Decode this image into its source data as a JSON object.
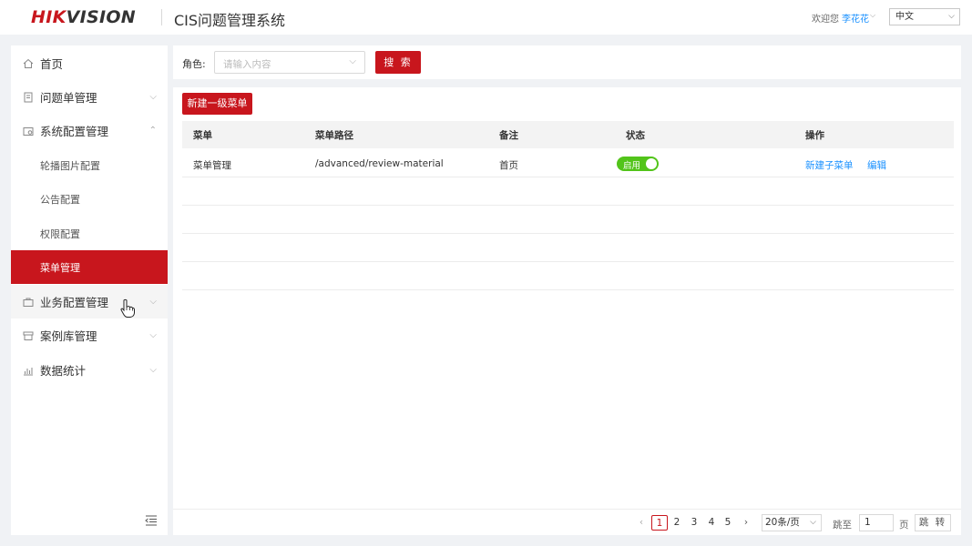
{
  "header": {
    "logo_main": "HIK",
    "logo_accent": "VISION",
    "app_title": "CIS问题管理系统",
    "welcome_text": "欢迎您",
    "username": "李花花",
    "language": "中文"
  },
  "sidebar": {
    "items": [
      {
        "label": "首页",
        "icon": "home-icon"
      },
      {
        "label": "问题单管理",
        "icon": "document-icon"
      },
      {
        "label": "系统配置管理",
        "icon": "settings-folder-icon",
        "expanded": true
      },
      {
        "label": "轮播图片配置"
      },
      {
        "label": "公告配置"
      },
      {
        "label": "权限配置"
      },
      {
        "label": "菜单管理",
        "active": true
      },
      {
        "label": "业务配置管理",
        "icon": "briefcase-icon"
      },
      {
        "label": "案例库管理",
        "icon": "archive-icon"
      },
      {
        "label": "数据统计",
        "icon": "chart-icon"
      }
    ]
  },
  "search": {
    "role_label": "角色:",
    "role_placeholder": "请输入内容",
    "search_button": "搜 索"
  },
  "main": {
    "new_button": "新建一级菜单",
    "columns": [
      "菜单",
      "菜单路径",
      "备注",
      "状态",
      "操作"
    ],
    "rows": [
      {
        "menu": "菜单管理",
        "path": "/advanced/review-material",
        "note": "首页",
        "status": "启用",
        "status_on": true,
        "actions": [
          "新建子菜单",
          "编辑"
        ]
      }
    ]
  },
  "pagination": {
    "pages": [
      "1",
      "2",
      "3",
      "4",
      "5"
    ],
    "current_page": "1",
    "page_size": "20条/页",
    "jump_label": "跳至",
    "jump_value": "1",
    "page_unit": "页",
    "jump_button": "跳 转"
  },
  "colors": {
    "brand_red": "#c8161d",
    "link_blue": "#1890ff",
    "toggle_green": "#52c41a"
  }
}
